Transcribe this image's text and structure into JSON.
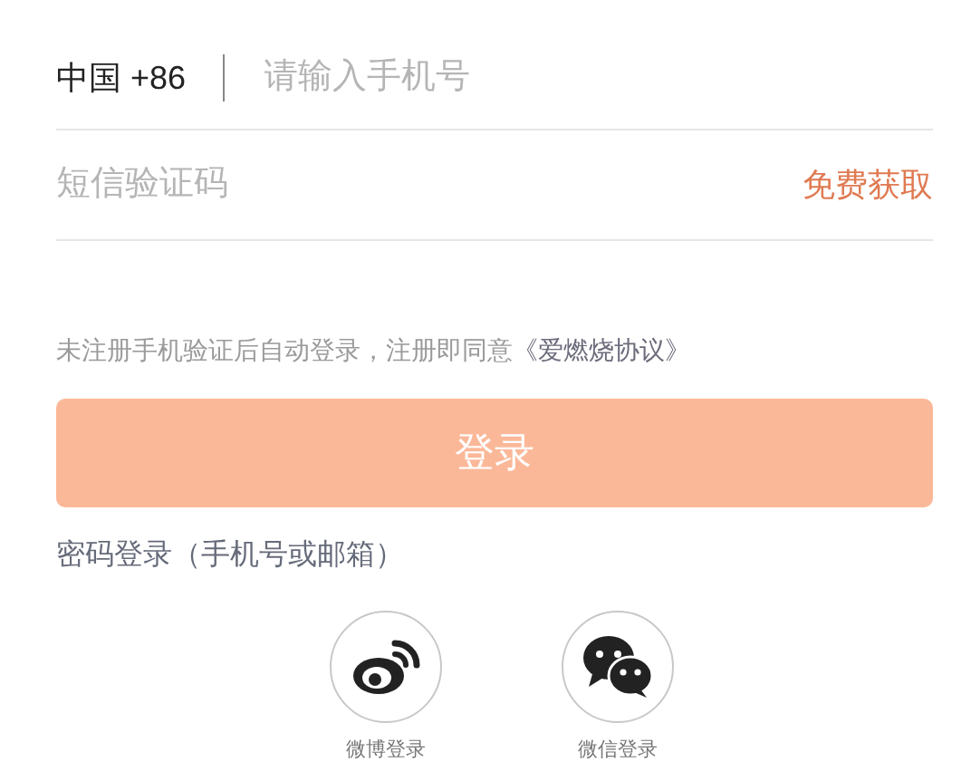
{
  "phone": {
    "country_code": "中国 +86",
    "placeholder": "请输入手机号"
  },
  "sms": {
    "placeholder": "短信验证码",
    "get_code": "免费获取"
  },
  "agreement": {
    "text": "未注册手机验证后自动登录，注册即同意",
    "link": "《爱燃烧协议》"
  },
  "login_button": {
    "label": "登录",
    "disabled": true
  },
  "password_login": "密码登录（手机号或邮箱）",
  "social_logins": [
    {
      "kind": "weibo",
      "label": "微博登录"
    },
    {
      "kind": "wechat",
      "label": "微信登录"
    }
  ]
}
